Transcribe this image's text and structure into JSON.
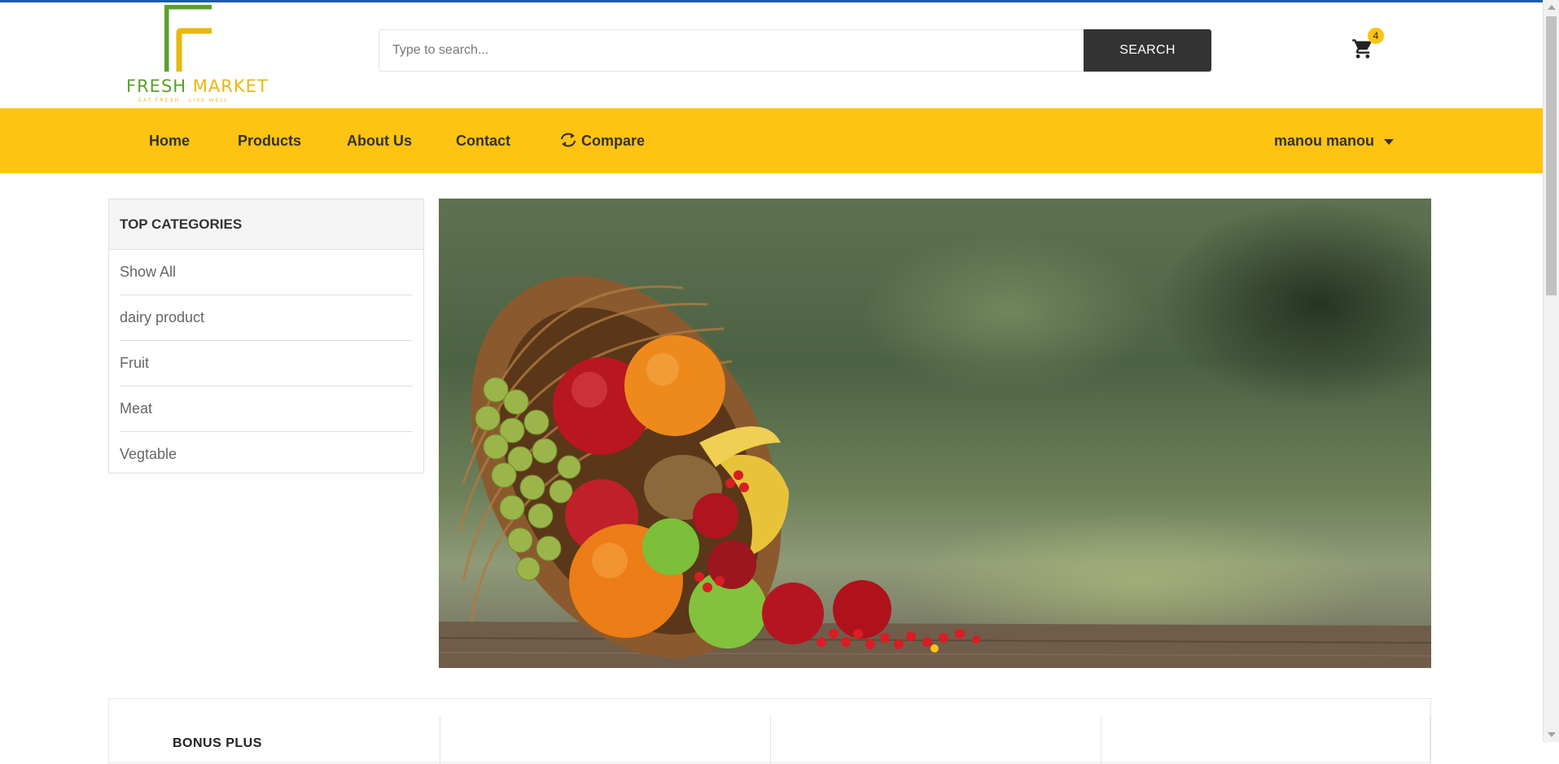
{
  "brand": {
    "name_part1": "FRESH",
    "name_part2": "MARKET",
    "tagline": "EAT FRESH . LIVE WELL",
    "green": "#5aa02c",
    "yellow": "#e8b80f"
  },
  "search": {
    "placeholder": "Type to search...",
    "value": "",
    "button_label": "SEARCH"
  },
  "cart": {
    "icon": "cart-icon",
    "count": "4"
  },
  "nav": {
    "items": [
      {
        "label": "Home"
      },
      {
        "label": "Products"
      },
      {
        "label": "About Us"
      },
      {
        "label": "Contact"
      },
      {
        "label": "Compare",
        "icon": "refresh-icon"
      }
    ],
    "user_label": "manou manou",
    "bar_color": "#ffc312"
  },
  "categories": {
    "title": "TOP CATEGORIES",
    "items": [
      {
        "label": "Show All"
      },
      {
        "label": "dairy product"
      },
      {
        "label": "Fruit"
      },
      {
        "label": "Meat"
      },
      {
        "label": "Vegtable"
      }
    ]
  },
  "hero": {
    "slide_count": 1,
    "active_slide": 1
  },
  "bonus": {
    "title": "BONUS PLUS"
  },
  "colors": {
    "accent": "#ffc312",
    "dark_button": "#333333",
    "top_border": "#1d5aa7"
  }
}
